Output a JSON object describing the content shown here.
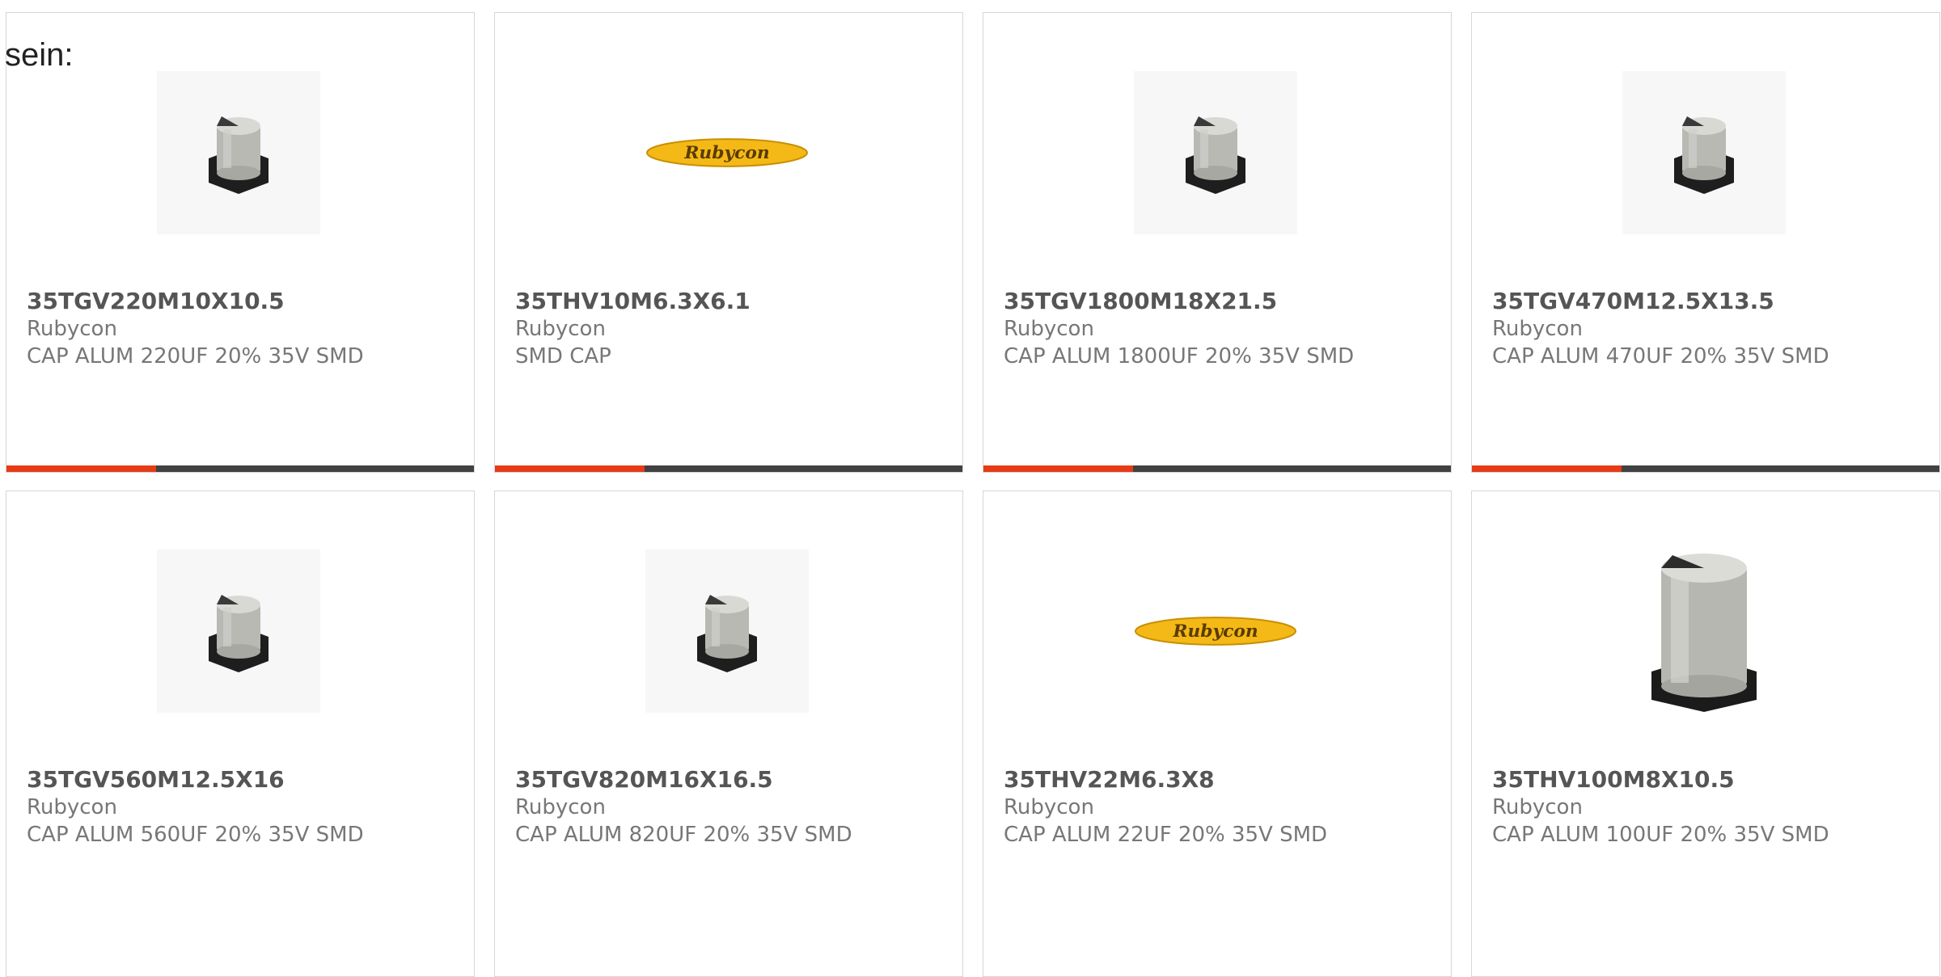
{
  "page_label": "sein:",
  "colors": {
    "accent": "#e63b16",
    "track": "#414141",
    "border": "#d6d6d6",
    "logo_yellow": "#f4b917"
  },
  "products": [
    {
      "part_number": "35TGV220M10X10.5",
      "manufacturer": "Rubycon",
      "description": "CAP ALUM 220UF 20% 35V SMD",
      "image": "capacitor-small-icon",
      "progress": 0.32
    },
    {
      "part_number": "35THV10M6.3X6.1",
      "manufacturer": "Rubycon",
      "description": "SMD CAP",
      "image": "rubycon-logo",
      "logo_text": "Rubycon",
      "progress": 0.32
    },
    {
      "part_number": "35TGV1800M18X21.5",
      "manufacturer": "Rubycon",
      "description": "CAP ALUM 1800UF 20% 35V SMD",
      "image": "capacitor-small-icon",
      "progress": 0.32
    },
    {
      "part_number": "35TGV470M12.5X13.5",
      "manufacturer": "Rubycon",
      "description": "CAP ALUM 470UF 20% 35V SMD",
      "image": "capacitor-small-icon",
      "progress": 0.32
    },
    {
      "part_number": "35TGV560M12.5X16",
      "manufacturer": "Rubycon",
      "description": "CAP ALUM 560UF 20% 35V SMD",
      "image": "capacitor-small-icon"
    },
    {
      "part_number": "35TGV820M16X16.5",
      "manufacturer": "Rubycon",
      "description": "CAP ALUM 820UF 20% 35V SMD",
      "image": "capacitor-small-icon"
    },
    {
      "part_number": "35THV22M6.3X8",
      "manufacturer": "Rubycon",
      "description": "CAP ALUM 22UF 20% 35V SMD",
      "image": "rubycon-logo",
      "logo_text": "Rubycon"
    },
    {
      "part_number": "35THV100M8X10.5",
      "manufacturer": "Rubycon",
      "description": "CAP ALUM 100UF 20% 35V SMD",
      "image": "capacitor-large-icon"
    }
  ]
}
